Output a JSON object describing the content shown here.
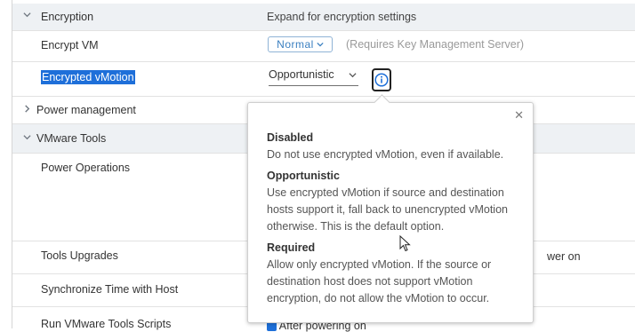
{
  "sections": {
    "encryption": {
      "label": "Encryption",
      "description": "Expand for encryption settings"
    },
    "power_management": {
      "label": "Power management"
    },
    "vmware_tools": {
      "label": "VMware Tools"
    }
  },
  "rows": {
    "encrypt_vm": {
      "label": "Encrypt VM",
      "value": "Normal",
      "note": "(Requires Key Management Server)"
    },
    "encrypted_vmotion": {
      "label": "Encrypted vMotion",
      "value": "Opportunistic"
    },
    "power_operations": {
      "label": "Power Operations"
    },
    "tools_upgrades": {
      "label": "Tools Upgrades",
      "value_fragment": "wer on"
    },
    "sync_time": {
      "label": "Synchronize Time with Host"
    },
    "run_scripts": {
      "label": "Run VMware Tools Scripts",
      "value_fragment": "After powering on"
    }
  },
  "popover": {
    "items": [
      {
        "title": "Disabled",
        "text": "Do not use encrypted vMotion, even if available."
      },
      {
        "title": "Opportunistic",
        "text": "Use encrypted vMotion if source and destination hosts support it, fall back to unencrypted vMotion otherwise. This is the default option."
      },
      {
        "title": "Required",
        "text": "Allow only encrypted vMotion. If the source or destination host does not support vMotion encryption, do not allow the vMotion to occur."
      }
    ]
  },
  "colors": {
    "accent": "#1e6fd9",
    "section_bg": "#eef1f4",
    "link_blue": "#3a7fc0"
  }
}
